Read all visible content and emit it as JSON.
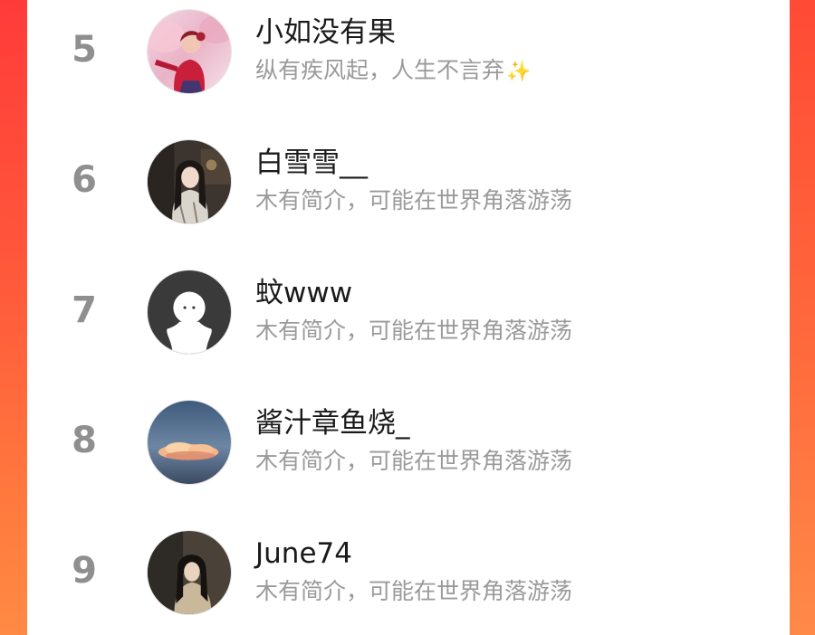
{
  "colors": {
    "background_gradient_top": "#ff3b3a",
    "background_gradient_bottom": "#ff8a44",
    "panel": "#ffffff",
    "rank_text": "#8f8f8f",
    "name_text": "#1a1a1a",
    "bio_text": "#9a9a9a"
  },
  "ranking_list": {
    "items": [
      {
        "rank": "5",
        "name": "小如没有果",
        "bio": "纵有疾风起，人生不言弃",
        "bio_emoji": "✨",
        "avatar": "woman-red-costume-avatar"
      },
      {
        "rank": "6",
        "name": "白雪雪__",
        "bio": "木有简介，可能在世界角落游荡",
        "avatar": "woman-long-hair-avatar"
      },
      {
        "rank": "7",
        "name": "蚊www",
        "bio": "木有简介，可能在世界角落游荡",
        "avatar": "default-user-avatar"
      },
      {
        "rank": "8",
        "name": "酱汁章鱼烧_",
        "bio": "木有简介，可能在世界角落游荡",
        "avatar": "sunset-cloud-avatar"
      },
      {
        "rank": "9",
        "name": "June74",
        "bio": "木有简介，可能在世界角落游荡",
        "avatar": "dark-portrait-avatar"
      }
    ]
  }
}
